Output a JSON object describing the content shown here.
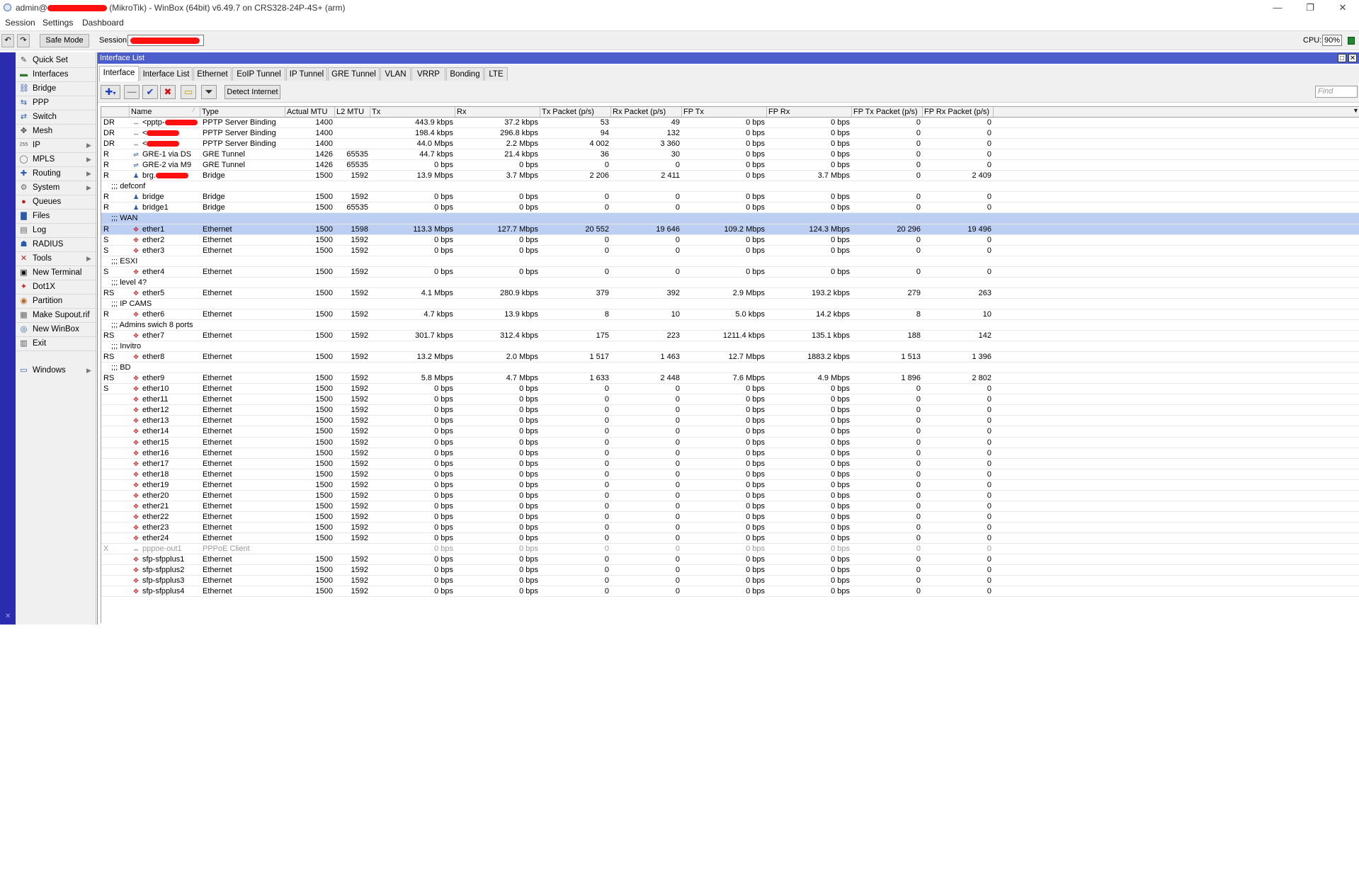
{
  "window": {
    "title_user": "admin@",
    "title_rest": "(MikroTik) - WinBox (64bit) v6.49.7 on CRS328-24P-4S+ (arm)",
    "minimize": "—",
    "restore": "❐",
    "close": "✕"
  },
  "menu": [
    "Session",
    "Settings",
    "Dashboard"
  ],
  "toolbar": {
    "undo": "↶",
    "redo": "↷",
    "safe_mode": "Safe Mode",
    "session_label": "Session:",
    "cpu_label": "CPU:",
    "cpu_value": "90%",
    "status_color": "#1f8a2b"
  },
  "sidebar": {
    "items": [
      {
        "label": "Quick Set",
        "icon": "quickset-icon",
        "glyph": "✎",
        "color": "#444"
      },
      {
        "label": "Interfaces",
        "icon": "interfaces-icon",
        "glyph": "▬",
        "color": "#2b7a2b"
      },
      {
        "label": "Bridge",
        "icon": "bridge-icon",
        "glyph": "⛓",
        "color": "#2a5aa8"
      },
      {
        "label": "PPP",
        "icon": "ppp-icon",
        "glyph": "⇆",
        "color": "#2a5aa8"
      },
      {
        "label": "Switch",
        "icon": "switch-icon",
        "glyph": "⇄",
        "color": "#2a5aa8"
      },
      {
        "label": "Mesh",
        "icon": "mesh-icon",
        "glyph": "✥",
        "color": "#444"
      },
      {
        "label": "IP",
        "icon": "ip-icon",
        "glyph": "255",
        "color": "#555",
        "arrow": true
      },
      {
        "label": "MPLS",
        "icon": "mpls-icon",
        "glyph": "◯",
        "color": "#666",
        "arrow": true
      },
      {
        "label": "Routing",
        "icon": "routing-icon",
        "glyph": "✚",
        "color": "#2a5aa8",
        "arrow": true
      },
      {
        "label": "System",
        "icon": "system-icon",
        "glyph": "⚙",
        "color": "#666",
        "arrow": true
      },
      {
        "label": "Queues",
        "icon": "queues-icon",
        "glyph": "●",
        "color": "#c02020"
      },
      {
        "label": "Files",
        "icon": "files-icon",
        "glyph": "▇",
        "color": "#2a5aa8"
      },
      {
        "label": "Log",
        "icon": "log-icon",
        "glyph": "▤",
        "color": "#666"
      },
      {
        "label": "RADIUS",
        "icon": "radius-icon",
        "glyph": "☗",
        "color": "#2a5aa8"
      },
      {
        "label": "Tools",
        "icon": "tools-icon",
        "glyph": "✕",
        "color": "#c02020",
        "arrow": true
      },
      {
        "label": "New Terminal",
        "icon": "terminal-icon",
        "glyph": "▣",
        "color": "#111"
      },
      {
        "label": "Dot1X",
        "icon": "dot1x-icon",
        "glyph": "✦",
        "color": "#c02020"
      },
      {
        "label": "Partition",
        "icon": "partition-icon",
        "glyph": "◉",
        "color": "#b5651d"
      },
      {
        "label": "Make Supout.rif",
        "icon": "supout-icon",
        "glyph": "▦",
        "color": "#666"
      },
      {
        "label": "New WinBox",
        "icon": "winbox-icon",
        "glyph": "◎",
        "color": "#2a5aa8"
      },
      {
        "label": "Exit",
        "icon": "exit-icon",
        "glyph": "▥",
        "color": "#555"
      }
    ],
    "windows_item": {
      "label": "Windows",
      "icon": "windows-icon",
      "glyph": "▭",
      "color": "#2a5aa8"
    }
  },
  "panel": {
    "title": "Interface List",
    "tabs": [
      "Interface",
      "Interface List",
      "Ethernet",
      "EoIP Tunnel",
      "IP Tunnel",
      "GRE Tunnel",
      "VLAN",
      "VRRP",
      "Bonding",
      "LTE"
    ],
    "active_tab": 0,
    "detect_internet": "Detect Internet",
    "find_placeholder": "Find",
    "columns": [
      "",
      "Name",
      "Type",
      "Actual MTU",
      "L2 MTU",
      "Tx",
      "Rx",
      "Tx Packet (p/s)",
      "Rx Packet (p/s)",
      "FP Tx",
      "FP Rx",
      "FP Tx Packet (p/s)",
      "FP Rx Packet (p/s)"
    ],
    "rows": [
      {
        "flag": "DR",
        "icon": "ppp",
        "name": "<pptp-",
        "redact": true,
        "type": "PPTP Server Binding",
        "mtu": "1400",
        "l2": "",
        "tx": "443.9 kbps",
        "rx": "37.2 kbps",
        "txp": "53",
        "rxp": "49",
        "fptx": "0 bps",
        "fprx": "0 bps",
        "fptxp": "0",
        "fprxp": "0"
      },
      {
        "flag": "DR",
        "icon": "ppp",
        "name": "<",
        "redact": true,
        "type": "PPTP Server Binding",
        "mtu": "1400",
        "l2": "",
        "tx": "198.4 kbps",
        "rx": "296.8 kbps",
        "txp": "94",
        "rxp": "132",
        "fptx": "0 bps",
        "fprx": "0 bps",
        "fptxp": "0",
        "fprxp": "0"
      },
      {
        "flag": "DR",
        "icon": "ppp",
        "name": "<",
        "redact": true,
        "type": "PPTP Server Binding",
        "mtu": "1400",
        "l2": "",
        "tx": "44.0 Mbps",
        "rx": "2.2 Mbps",
        "txp": "4 002",
        "rxp": "3 360",
        "fptx": "0 bps",
        "fprx": "0 bps",
        "fptxp": "0",
        "fprxp": "0"
      },
      {
        "flag": "R",
        "icon": "gre",
        "name": "GRE-1 via DS",
        "type": "GRE Tunnel",
        "mtu": "1426",
        "l2": "65535",
        "tx": "44.7 kbps",
        "rx": "21.4 kbps",
        "txp": "36",
        "rxp": "30",
        "fptx": "0 bps",
        "fprx": "0 bps",
        "fptxp": "0",
        "fprxp": "0"
      },
      {
        "flag": "R",
        "icon": "gre",
        "name": "GRE-2 via M9",
        "type": "GRE Tunnel",
        "mtu": "1426",
        "l2": "65535",
        "tx": "0 bps",
        "rx": "0 bps",
        "txp": "0",
        "rxp": "0",
        "fptx": "0 bps",
        "fprx": "0 bps",
        "fptxp": "0",
        "fprxp": "0"
      },
      {
        "flag": "R",
        "icon": "bridge",
        "name": "brg.",
        "redact": true,
        "type": "Bridge",
        "mtu": "1500",
        "l2": "1592",
        "tx": "13.9 Mbps",
        "rx": "3.7 Mbps",
        "txp": "2 206",
        "rxp": "2 411",
        "fptx": "0 bps",
        "fprx": "3.7 Mbps",
        "fptxp": "0",
        "fprxp": "2 409"
      },
      {
        "comment": ";;; defconf"
      },
      {
        "flag": "R",
        "icon": "bridge",
        "name": "bridge",
        "type": "Bridge",
        "mtu": "1500",
        "l2": "1592",
        "tx": "0 bps",
        "rx": "0 bps",
        "txp": "0",
        "rxp": "0",
        "fptx": "0 bps",
        "fprx": "0 bps",
        "fptxp": "0",
        "fprxp": "0"
      },
      {
        "flag": "R",
        "icon": "bridge",
        "name": "bridge1",
        "type": "Bridge",
        "mtu": "1500",
        "l2": "65535",
        "tx": "0 bps",
        "rx": "0 bps",
        "txp": "0",
        "rxp": "0",
        "fptx": "0 bps",
        "fprx": "0 bps",
        "fptxp": "0",
        "fprxp": "0"
      },
      {
        "comment": ";;; WAN",
        "selected": true
      },
      {
        "flag": "R",
        "icon": "eth",
        "name": "ether1",
        "type": "Ethernet",
        "mtu": "1500",
        "l2": "1598",
        "tx": "113.3 Mbps",
        "rx": "127.7 Mbps",
        "txp": "20 552",
        "rxp": "19 646",
        "fptx": "109.2 Mbps",
        "fprx": "124.3 Mbps",
        "fptxp": "20 296",
        "fprxp": "19 496",
        "selected": true
      },
      {
        "flag": "S",
        "icon": "eth",
        "name": "ether2",
        "type": "Ethernet",
        "mtu": "1500",
        "l2": "1592",
        "tx": "0 bps",
        "rx": "0 bps",
        "txp": "0",
        "rxp": "0",
        "fptx": "0 bps",
        "fprx": "0 bps",
        "fptxp": "0",
        "fprxp": "0"
      },
      {
        "flag": "S",
        "icon": "eth",
        "name": "ether3",
        "type": "Ethernet",
        "mtu": "1500",
        "l2": "1592",
        "tx": "0 bps",
        "rx": "0 bps",
        "txp": "0",
        "rxp": "0",
        "fptx": "0 bps",
        "fprx": "0 bps",
        "fptxp": "0",
        "fprxp": "0"
      },
      {
        "comment": ";;; ESXI"
      },
      {
        "flag": "S",
        "icon": "eth",
        "name": "ether4",
        "type": "Ethernet",
        "mtu": "1500",
        "l2": "1592",
        "tx": "0 bps",
        "rx": "0 bps",
        "txp": "0",
        "rxp": "0",
        "fptx": "0 bps",
        "fprx": "0 bps",
        "fptxp": "0",
        "fprxp": "0"
      },
      {
        "comment": ";;; level 4?"
      },
      {
        "flag": "RS",
        "icon": "eth",
        "name": "ether5",
        "type": "Ethernet",
        "mtu": "1500",
        "l2": "1592",
        "tx": "4.1 Mbps",
        "rx": "280.9 kbps",
        "txp": "379",
        "rxp": "392",
        "fptx": "2.9 Mbps",
        "fprx": "193.2 kbps",
        "fptxp": "279",
        "fprxp": "263"
      },
      {
        "comment": ";;; IP CAMS"
      },
      {
        "flag": "R",
        "icon": "eth",
        "name": "ether6",
        "type": "Ethernet",
        "mtu": "1500",
        "l2": "1592",
        "tx": "4.7 kbps",
        "rx": "13.9 kbps",
        "txp": "8",
        "rxp": "10",
        "fptx": "5.0 kbps",
        "fprx": "14.2 kbps",
        "fptxp": "8",
        "fprxp": "10"
      },
      {
        "comment": ";;; Admins swich 8 ports"
      },
      {
        "flag": "RS",
        "icon": "eth",
        "name": "ether7",
        "type": "Ethernet",
        "mtu": "1500",
        "l2": "1592",
        "tx": "301.7 kbps",
        "rx": "312.4 kbps",
        "txp": "175",
        "rxp": "223",
        "fptx": "1211.4 kbps",
        "fprx": "135.1 kbps",
        "fptxp": "188",
        "fprxp": "142"
      },
      {
        "comment": ";;; Invitro"
      },
      {
        "flag": "RS",
        "icon": "eth",
        "name": "ether8",
        "type": "Ethernet",
        "mtu": "1500",
        "l2": "1592",
        "tx": "13.2 Mbps",
        "rx": "2.0 Mbps",
        "txp": "1 517",
        "rxp": "1 463",
        "fptx": "12.7 Mbps",
        "fprx": "1883.2 kbps",
        "fptxp": "1 513",
        "fprxp": "1 396"
      },
      {
        "comment": ";;; BD"
      },
      {
        "flag": "RS",
        "icon": "eth",
        "name": "ether9",
        "type": "Ethernet",
        "mtu": "1500",
        "l2": "1592",
        "tx": "5.8 Mbps",
        "rx": "4.7 Mbps",
        "txp": "1 633",
        "rxp": "2 448",
        "fptx": "7.6 Mbps",
        "fprx": "4.9 Mbps",
        "fptxp": "1 896",
        "fprxp": "2 802"
      },
      {
        "flag": "S",
        "icon": "eth",
        "name": "ether10",
        "type": "Ethernet",
        "mtu": "1500",
        "l2": "1592",
        "tx": "0 bps",
        "rx": "0 bps",
        "txp": "0",
        "rxp": "0",
        "fptx": "0 bps",
        "fprx": "0 bps",
        "fptxp": "0",
        "fprxp": "0"
      },
      {
        "flag": "",
        "icon": "eth",
        "name": "ether11",
        "type": "Ethernet",
        "mtu": "1500",
        "l2": "1592",
        "tx": "0 bps",
        "rx": "0 bps",
        "txp": "0",
        "rxp": "0",
        "fptx": "0 bps",
        "fprx": "0 bps",
        "fptxp": "0",
        "fprxp": "0"
      },
      {
        "flag": "",
        "icon": "eth",
        "name": "ether12",
        "type": "Ethernet",
        "mtu": "1500",
        "l2": "1592",
        "tx": "0 bps",
        "rx": "0 bps",
        "txp": "0",
        "rxp": "0",
        "fptx": "0 bps",
        "fprx": "0 bps",
        "fptxp": "0",
        "fprxp": "0"
      },
      {
        "flag": "",
        "icon": "eth",
        "name": "ether13",
        "type": "Ethernet",
        "mtu": "1500",
        "l2": "1592",
        "tx": "0 bps",
        "rx": "0 bps",
        "txp": "0",
        "rxp": "0",
        "fptx": "0 bps",
        "fprx": "0 bps",
        "fptxp": "0",
        "fprxp": "0"
      },
      {
        "flag": "",
        "icon": "eth",
        "name": "ether14",
        "type": "Ethernet",
        "mtu": "1500",
        "l2": "1592",
        "tx": "0 bps",
        "rx": "0 bps",
        "txp": "0",
        "rxp": "0",
        "fptx": "0 bps",
        "fprx": "0 bps",
        "fptxp": "0",
        "fprxp": "0"
      },
      {
        "flag": "",
        "icon": "eth",
        "name": "ether15",
        "type": "Ethernet",
        "mtu": "1500",
        "l2": "1592",
        "tx": "0 bps",
        "rx": "0 bps",
        "txp": "0",
        "rxp": "0",
        "fptx": "0 bps",
        "fprx": "0 bps",
        "fptxp": "0",
        "fprxp": "0"
      },
      {
        "flag": "",
        "icon": "eth",
        "name": "ether16",
        "type": "Ethernet",
        "mtu": "1500",
        "l2": "1592",
        "tx": "0 bps",
        "rx": "0 bps",
        "txp": "0",
        "rxp": "0",
        "fptx": "0 bps",
        "fprx": "0 bps",
        "fptxp": "0",
        "fprxp": "0"
      },
      {
        "flag": "",
        "icon": "eth",
        "name": "ether17",
        "type": "Ethernet",
        "mtu": "1500",
        "l2": "1592",
        "tx": "0 bps",
        "rx": "0 bps",
        "txp": "0",
        "rxp": "0",
        "fptx": "0 bps",
        "fprx": "0 bps",
        "fptxp": "0",
        "fprxp": "0"
      },
      {
        "flag": "",
        "icon": "eth",
        "name": "ether18",
        "type": "Ethernet",
        "mtu": "1500",
        "l2": "1592",
        "tx": "0 bps",
        "rx": "0 bps",
        "txp": "0",
        "rxp": "0",
        "fptx": "0 bps",
        "fprx": "0 bps",
        "fptxp": "0",
        "fprxp": "0"
      },
      {
        "flag": "",
        "icon": "eth",
        "name": "ether19",
        "type": "Ethernet",
        "mtu": "1500",
        "l2": "1592",
        "tx": "0 bps",
        "rx": "0 bps",
        "txp": "0",
        "rxp": "0",
        "fptx": "0 bps",
        "fprx": "0 bps",
        "fptxp": "0",
        "fprxp": "0"
      },
      {
        "flag": "",
        "icon": "eth",
        "name": "ether20",
        "type": "Ethernet",
        "mtu": "1500",
        "l2": "1592",
        "tx": "0 bps",
        "rx": "0 bps",
        "txp": "0",
        "rxp": "0",
        "fptx": "0 bps",
        "fprx": "0 bps",
        "fptxp": "0",
        "fprxp": "0"
      },
      {
        "flag": "",
        "icon": "eth",
        "name": "ether21",
        "type": "Ethernet",
        "mtu": "1500",
        "l2": "1592",
        "tx": "0 bps",
        "rx": "0 bps",
        "txp": "0",
        "rxp": "0",
        "fptx": "0 bps",
        "fprx": "0 bps",
        "fptxp": "0",
        "fprxp": "0"
      },
      {
        "flag": "",
        "icon": "eth",
        "name": "ether22",
        "type": "Ethernet",
        "mtu": "1500",
        "l2": "1592",
        "tx": "0 bps",
        "rx": "0 bps",
        "txp": "0",
        "rxp": "0",
        "fptx": "0 bps",
        "fprx": "0 bps",
        "fptxp": "0",
        "fprxp": "0"
      },
      {
        "flag": "",
        "icon": "eth",
        "name": "ether23",
        "type": "Ethernet",
        "mtu": "1500",
        "l2": "1592",
        "tx": "0 bps",
        "rx": "0 bps",
        "txp": "0",
        "rxp": "0",
        "fptx": "0 bps",
        "fprx": "0 bps",
        "fptxp": "0",
        "fprxp": "0"
      },
      {
        "flag": "",
        "icon": "eth",
        "name": "ether24",
        "type": "Ethernet",
        "mtu": "1500",
        "l2": "1592",
        "tx": "0 bps",
        "rx": "0 bps",
        "txp": "0",
        "rxp": "0",
        "fptx": "0 bps",
        "fprx": "0 bps",
        "fptxp": "0",
        "fprxp": "0"
      },
      {
        "flag": "X",
        "icon": "ppp",
        "name": "pppoe-out1",
        "type": "PPPoE Client",
        "mtu": "",
        "l2": "",
        "tx": "0 bps",
        "rx": "0 bps",
        "txp": "0",
        "rxp": "0",
        "fptx": "0 bps",
        "fprx": "0 bps",
        "fptxp": "0",
        "fprxp": "0",
        "disabled": true
      },
      {
        "flag": "",
        "icon": "eth",
        "name": "sfp-sfpplus1",
        "type": "Ethernet",
        "mtu": "1500",
        "l2": "1592",
        "tx": "0 bps",
        "rx": "0 bps",
        "txp": "0",
        "rxp": "0",
        "fptx": "0 bps",
        "fprx": "0 bps",
        "fptxp": "0",
        "fprxp": "0"
      },
      {
        "flag": "",
        "icon": "eth",
        "name": "sfp-sfpplus2",
        "type": "Ethernet",
        "mtu": "1500",
        "l2": "1592",
        "tx": "0 bps",
        "rx": "0 bps",
        "txp": "0",
        "rxp": "0",
        "fptx": "0 bps",
        "fprx": "0 bps",
        "fptxp": "0",
        "fprxp": "0"
      },
      {
        "flag": "",
        "icon": "eth",
        "name": "sfp-sfpplus3",
        "type": "Ethernet",
        "mtu": "1500",
        "l2": "1592",
        "tx": "0 bps",
        "rx": "0 bps",
        "txp": "0",
        "rxp": "0",
        "fptx": "0 bps",
        "fprx": "0 bps",
        "fptxp": "0",
        "fprxp": "0"
      },
      {
        "flag": "",
        "icon": "eth",
        "name": "sfp-sfpplus4",
        "type": "Ethernet",
        "mtu": "1500",
        "l2": "1592",
        "tx": "0 bps",
        "rx": "0 bps",
        "txp": "0",
        "rxp": "0",
        "fptx": "0 bps",
        "fprx": "0 bps",
        "fptxp": "0",
        "fprxp": "0"
      }
    ]
  }
}
